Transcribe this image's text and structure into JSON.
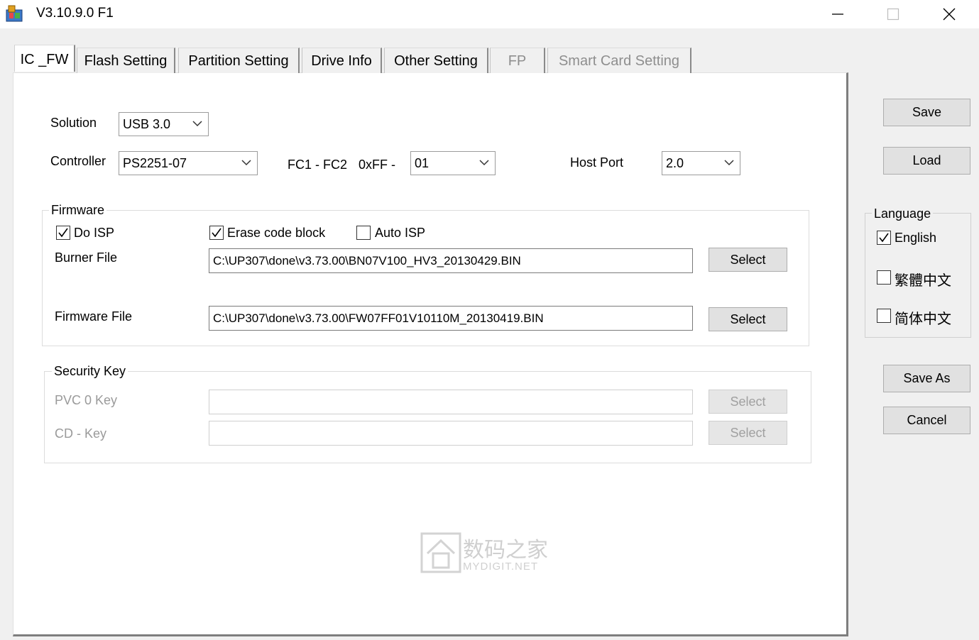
{
  "window": {
    "title": "V3.10.9.0 F1"
  },
  "tabs": [
    {
      "label": "IC _FW",
      "state": "active"
    },
    {
      "label": "Flash Setting",
      "state": "normal"
    },
    {
      "label": "Partition Setting",
      "state": "normal"
    },
    {
      "label": "Drive Info",
      "state": "normal"
    },
    {
      "label": "Other Setting",
      "state": "normal"
    },
    {
      "label": "FP",
      "state": "disabled"
    },
    {
      "label": "Smart Card Setting",
      "state": "disabled"
    }
  ],
  "config": {
    "solution_label": "Solution",
    "solution_value": "USB 3.0",
    "controller_label": "Controller",
    "controller_value": "PS2251-07",
    "fc_label": "FC1 - FC2",
    "fc_prefix": "0xFF -",
    "fc_value": "01",
    "hostport_label": "Host Port",
    "hostport_value": "2.0"
  },
  "firmware": {
    "title": "Firmware",
    "do_isp_label": "Do ISP",
    "do_isp_checked": true,
    "erase_label": "Erase code block",
    "erase_checked": true,
    "auto_isp_label": "Auto ISP",
    "auto_isp_checked": false,
    "burner_label": "Burner File",
    "burner_path": "C:\\UP307\\done\\v3.73.00\\BN07V100_HV3_20130429.BIN",
    "burner_select": "Select",
    "firmware_label": "Firmware File",
    "firmware_path": "C:\\UP307\\done\\v3.73.00\\FW07FF01V10110M_20130419.BIN",
    "firmware_select": "Select"
  },
  "security": {
    "title": "Security Key",
    "pvc_label": "PVC 0 Key",
    "pvc_value": "",
    "pvc_select": "Select",
    "cd_label": "CD - Key",
    "cd_value": "",
    "cd_select": "Select"
  },
  "sidebar": {
    "save": "Save",
    "load": "Load",
    "language_title": "Language",
    "languages": [
      {
        "label": "English",
        "checked": true
      },
      {
        "label": "繁體中文",
        "checked": false
      },
      {
        "label": "简体中文",
        "checked": false
      }
    ],
    "save_as": "Save As",
    "cancel": "Cancel"
  },
  "watermark": {
    "cn": "数码之家",
    "en": "MYDIGIT.NET"
  }
}
